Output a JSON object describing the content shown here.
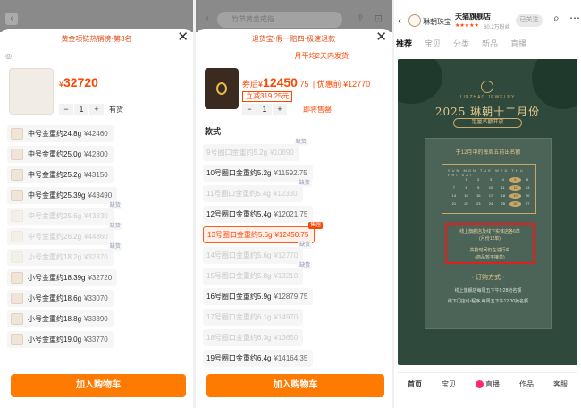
{
  "panel1": {
    "search_placeholder": "",
    "header_promo": "黄金项链热销榜·第3名",
    "price_symbol": "¥",
    "price": "32720",
    "quantity": "1",
    "stock_status": "有货",
    "options": [
      {
        "label": "中号金重约24.8g",
        "price": "¥42460",
        "disabled": false
      },
      {
        "label": "中号金重约25.0g",
        "price": "¥42800",
        "disabled": false
      },
      {
        "label": "中号金重约25.2g",
        "price": "¥43150",
        "disabled": false
      },
      {
        "label": "中号金重约25.39g",
        "price": "¥43490",
        "disabled": false
      },
      {
        "label": "中号金重约25.6g",
        "price": "¥43830",
        "disabled": true,
        "badge": "缺货"
      },
      {
        "label": "中号金重约26.2g",
        "price": "¥44860",
        "disabled": true,
        "badge": "缺货"
      },
      {
        "label": "小号金重约18.2g",
        "price": "¥32370",
        "disabled": true,
        "badge": "缺货"
      },
      {
        "label": "小号金重约18.39g",
        "price": "¥32720",
        "disabled": false
      },
      {
        "label": "小号金重约18.6g",
        "price": "¥33070",
        "disabled": false
      },
      {
        "label": "小号金重约18.8g",
        "price": "¥33390",
        "disabled": false
      },
      {
        "label": "小号金重约19.0g",
        "price": "¥33770",
        "disabled": false
      }
    ],
    "cart_button": "加入购物车"
  },
  "panel2": {
    "search_placeholder": "竹节黄金戒指",
    "header_promo": "退货宝·假一赔四·极速退款",
    "shipping_note": "月平均2天内发货",
    "price_prefix": "券后",
    "price_symbol": "¥",
    "price_int": "12450",
    "price_dec": ".75",
    "price_orig": "优惠前 ¥12770",
    "coupon": "立减319.25元",
    "quantity": "1",
    "stock_status": "即将售罄",
    "section_label": "款式",
    "options": [
      {
        "label": "9号圈口金重约5.2g",
        "price": "¥10890",
        "disabled": true,
        "badge": "缺货"
      },
      {
        "label": "10号圈口金重约5.2g",
        "price": "¥11592.75",
        "disabled": false
      },
      {
        "label": "11号圈口金重约5.4g",
        "price": "¥12330",
        "disabled": true,
        "badge": "缺货"
      },
      {
        "label": "12号圈口金重约5.4g",
        "price": "¥12021.75",
        "disabled": false
      },
      {
        "label": "13号圈口金重约5.6g",
        "price": "¥12450.75",
        "disabled": false,
        "selected": true,
        "badge": "售罄"
      },
      {
        "label": "14号圈口金重约5.6g",
        "price": "¥12770",
        "disabled": true,
        "badge": "缺货"
      },
      {
        "label": "15号圈口金重约5.8g",
        "price": "¥13210",
        "disabled": true,
        "badge": "缺货"
      },
      {
        "label": "16号圈口金重约5.9g",
        "price": "¥12879.75",
        "disabled": false
      },
      {
        "label": "17号圈口金重约6.1g",
        "price": "¥14970",
        "disabled": true
      },
      {
        "label": "18号圈口金重约6.3g",
        "price": "¥13650",
        "disabled": true
      },
      {
        "label": "19号圈口金重约6.4g",
        "price": "¥14164.35",
        "disabled": false
      }
    ],
    "cart_button": "加入购物车"
  },
  "panel3": {
    "shop_name": "琳朝珠宝",
    "brand_label": "天猫旗舰店",
    "rating": "★★★★★",
    "fans": "60.2万粉丝",
    "follow": "已关注",
    "tabs": [
      "推荐",
      "宝贝",
      "分类",
      "新品",
      "直播"
    ],
    "poster": {
      "brand_text": "LINZHAO JEWELRY",
      "title": "2025 琳朝十二月份",
      "subtitle": "定量名额开放",
      "caption": "于12月中的每周五前出名额",
      "cal_days": "SUN MON TUE WED THU FRI SAT",
      "dates": [
        "",
        "1",
        "2",
        "3",
        "4",
        "5",
        "6",
        "7",
        "8",
        "9",
        "10",
        "11",
        "12",
        "13",
        "14",
        "15",
        "16",
        "17",
        "18",
        "19",
        "20",
        "21",
        "22",
        "23",
        "24",
        "25",
        "26",
        "27"
      ],
      "marked": [
        "5",
        "12",
        "19",
        "26"
      ],
      "box_line1": "线上旗舰店及线下实体店各6单",
      "box_line2": "(月份12单)",
      "box_line3": "共抢时间仍在进行中",
      "box_line4": "(商品暂不接单)",
      "section": "· 订购方式 ·",
      "line1": "线上旗舰店每周五下午5:28抢名额",
      "line2": "线下门店/小程序,每周五下午12:30抢名额"
    },
    "nav": [
      "首页",
      "宝贝",
      "直播",
      "作品",
      "客服"
    ]
  }
}
